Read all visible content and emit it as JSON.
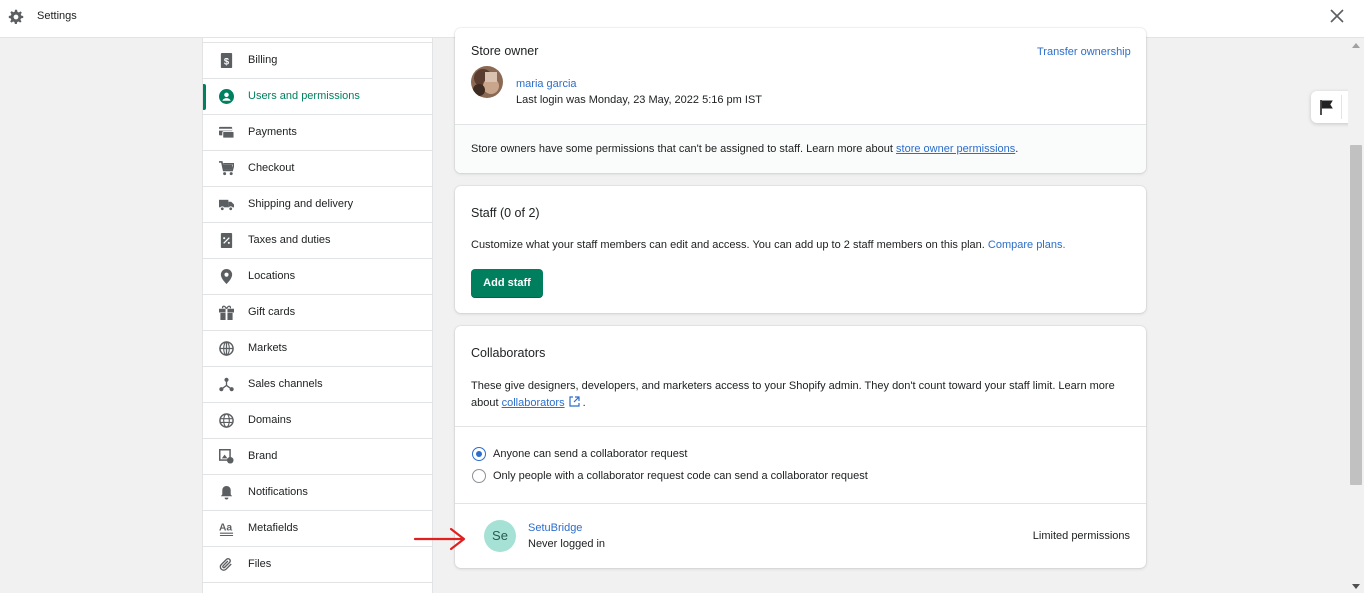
{
  "window": {
    "title": "Settings"
  },
  "sidebar": {
    "items": [
      {
        "label": "Billing",
        "icon": "billing-icon",
        "active": false
      },
      {
        "label": "Users and permissions",
        "icon": "user-icon",
        "active": true
      },
      {
        "label": "Payments",
        "icon": "payments-icon",
        "active": false
      },
      {
        "label": "Checkout",
        "icon": "cart-icon",
        "active": false
      },
      {
        "label": "Shipping and delivery",
        "icon": "truck-icon",
        "active": false
      },
      {
        "label": "Taxes and duties",
        "icon": "tax-icon",
        "active": false
      },
      {
        "label": "Locations",
        "icon": "location-pin-icon",
        "active": false
      },
      {
        "label": "Gift cards",
        "icon": "gift-icon",
        "active": false
      },
      {
        "label": "Markets",
        "icon": "globe-grid-icon",
        "active": false
      },
      {
        "label": "Sales channels",
        "icon": "channels-icon",
        "active": false
      },
      {
        "label": "Domains",
        "icon": "globe-icon",
        "active": false
      },
      {
        "label": "Brand",
        "icon": "brand-icon",
        "active": false
      },
      {
        "label": "Notifications",
        "icon": "bell-icon",
        "active": false
      },
      {
        "label": "Metafields",
        "icon": "metafields-icon",
        "active": false
      },
      {
        "label": "Files",
        "icon": "paperclip-icon",
        "active": false
      }
    ]
  },
  "store_owner": {
    "heading": "Store owner",
    "transfer_link": "Transfer ownership",
    "name": "maria garcia",
    "last_login": "Last login was Monday, 23 May, 2022 5:16 pm IST",
    "note_prefix": "Store owners have some permissions that can't be assigned to staff. Learn more about ",
    "note_link": "store owner permissions",
    "note_suffix": "."
  },
  "staff": {
    "heading": "Staff (0 of 2)",
    "desc_prefix": "Customize what your staff members can edit and access. You can add up to 2 staff members on this plan. ",
    "desc_link": "Compare plans.",
    "button": "Add staff"
  },
  "collaborators": {
    "heading": "Collaborators",
    "desc_line1": "These give designers, developers, and marketers access to your Shopify admin. They don't count toward your staff limit. Learn more",
    "desc_prefix2": "about ",
    "desc_link": "collaborators",
    "desc_suffix2": " .",
    "options": [
      {
        "label": "Anyone can send a collaborator request",
        "checked": true
      },
      {
        "label": "Only people with a collaborator request code can send a collaborator request",
        "checked": false
      }
    ],
    "member": {
      "initials": "Se",
      "name": "SetuBridge",
      "status": "Never logged in",
      "permissions": "Limited permissions"
    }
  },
  "colors": {
    "accent_green": "#008060",
    "primary_button": "#007f5f",
    "link_blue": "#2c6ecb",
    "annotation_red": "#e02020",
    "avatar_teal": "#a6e1d5"
  }
}
